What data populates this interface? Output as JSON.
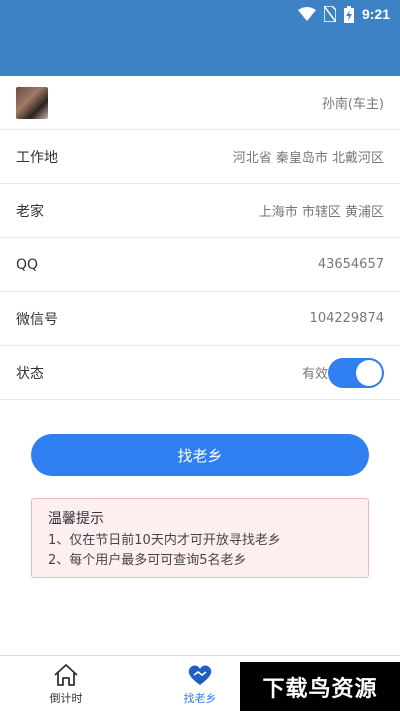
{
  "status_bar": {
    "time": "9:21"
  },
  "profile": {
    "name": "孙南(车主)",
    "rows": [
      {
        "label": "工作地",
        "value": "河北省 秦皇岛市 北戴河区"
      },
      {
        "label": "老家",
        "value": "上海市 市辖区 黄浦区"
      },
      {
        "label": "QQ",
        "value": "43654657"
      },
      {
        "label": "微信号",
        "value": "104229874"
      }
    ],
    "status": {
      "label": "状态",
      "value": "有效",
      "enabled": true
    }
  },
  "action": {
    "find_button": "找老乡"
  },
  "notice": {
    "title": "温馨提示",
    "lines": [
      "1、仅在节日前10天内才可开放寻找老乡",
      "2、每个用户最多可可查询5名老乡"
    ]
  },
  "tabs": [
    {
      "label": "倒计时",
      "icon": "home-icon",
      "active": false
    },
    {
      "label": "找老乡",
      "icon": "handshake-heart-icon",
      "active": true
    }
  ],
  "watermark": "下载鸟资源",
  "colors": {
    "header": "#3e82c6",
    "accent": "#2f7ff0",
    "notice_bg": "#fdeff0",
    "notice_border": "#f2b8bb"
  }
}
